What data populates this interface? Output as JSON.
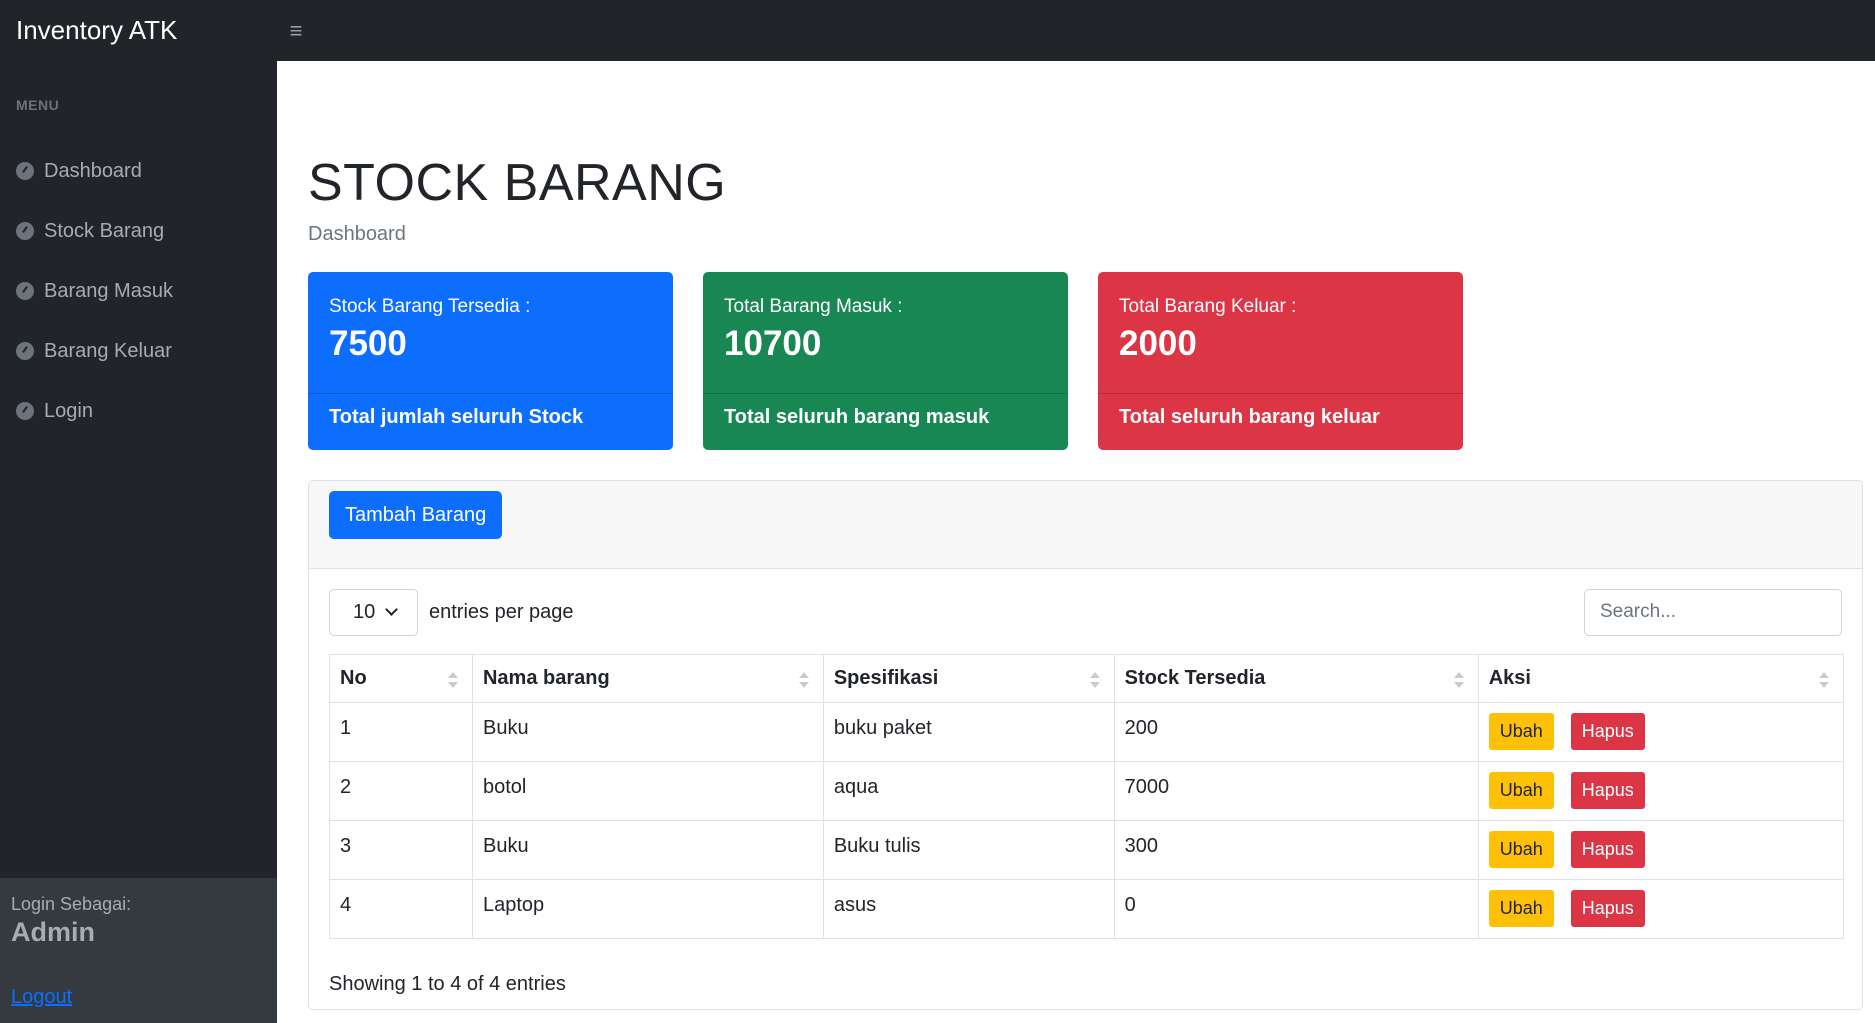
{
  "app": {
    "brand": "Inventory ATK",
    "toggle_icon": "≡"
  },
  "sidebar": {
    "heading": "MENU",
    "items": [
      {
        "label": "Dashboard"
      },
      {
        "label": "Stock Barang"
      },
      {
        "label": "Barang Masuk"
      },
      {
        "label": "Barang Keluar"
      },
      {
        "label": "Login"
      }
    ],
    "footer": {
      "login_as": "Login Sebagai:",
      "user": "Admin",
      "logout": "Logout"
    }
  },
  "page": {
    "title": "STOCK BARANG",
    "breadcrumb": "Dashboard"
  },
  "cards": [
    {
      "label": "Stock Barang Tersedia :",
      "value": "7500",
      "footer": "Total jumlah seluruh Stock",
      "color": "#0d6efd"
    },
    {
      "label": "Total Barang Masuk :",
      "value": "10700",
      "footer": "Total seluruh barang masuk",
      "color": "#198754"
    },
    {
      "label": "Total Barang Keluar :",
      "value": "2000",
      "footer": "Total seluruh barang keluar",
      "color": "#dc3545"
    }
  ],
  "panel": {
    "add_button": "Tambah Barang",
    "per_page_value": "10",
    "per_page_label": "entries per page",
    "search_placeholder": "Search...",
    "columns": [
      "No",
      "Nama barang",
      "Spesifikasi",
      "Stock Tersedia",
      "Aksi"
    ],
    "rows": [
      {
        "no": "1",
        "nama": "Buku",
        "spesifikasi": "buku paket",
        "stock": "200"
      },
      {
        "no": "2",
        "nama": "botol",
        "spesifikasi": "aqua",
        "stock": "7000"
      },
      {
        "no": "3",
        "nama": "Buku",
        "spesifikasi": "Buku tulis",
        "stock": "300"
      },
      {
        "no": "4",
        "nama": "Laptop",
        "spesifikasi": "asus",
        "stock": "0"
      }
    ],
    "edit_label": "Ubah",
    "delete_label": "Hapus",
    "showing": "Showing 1 to 4 of 4 entries"
  }
}
